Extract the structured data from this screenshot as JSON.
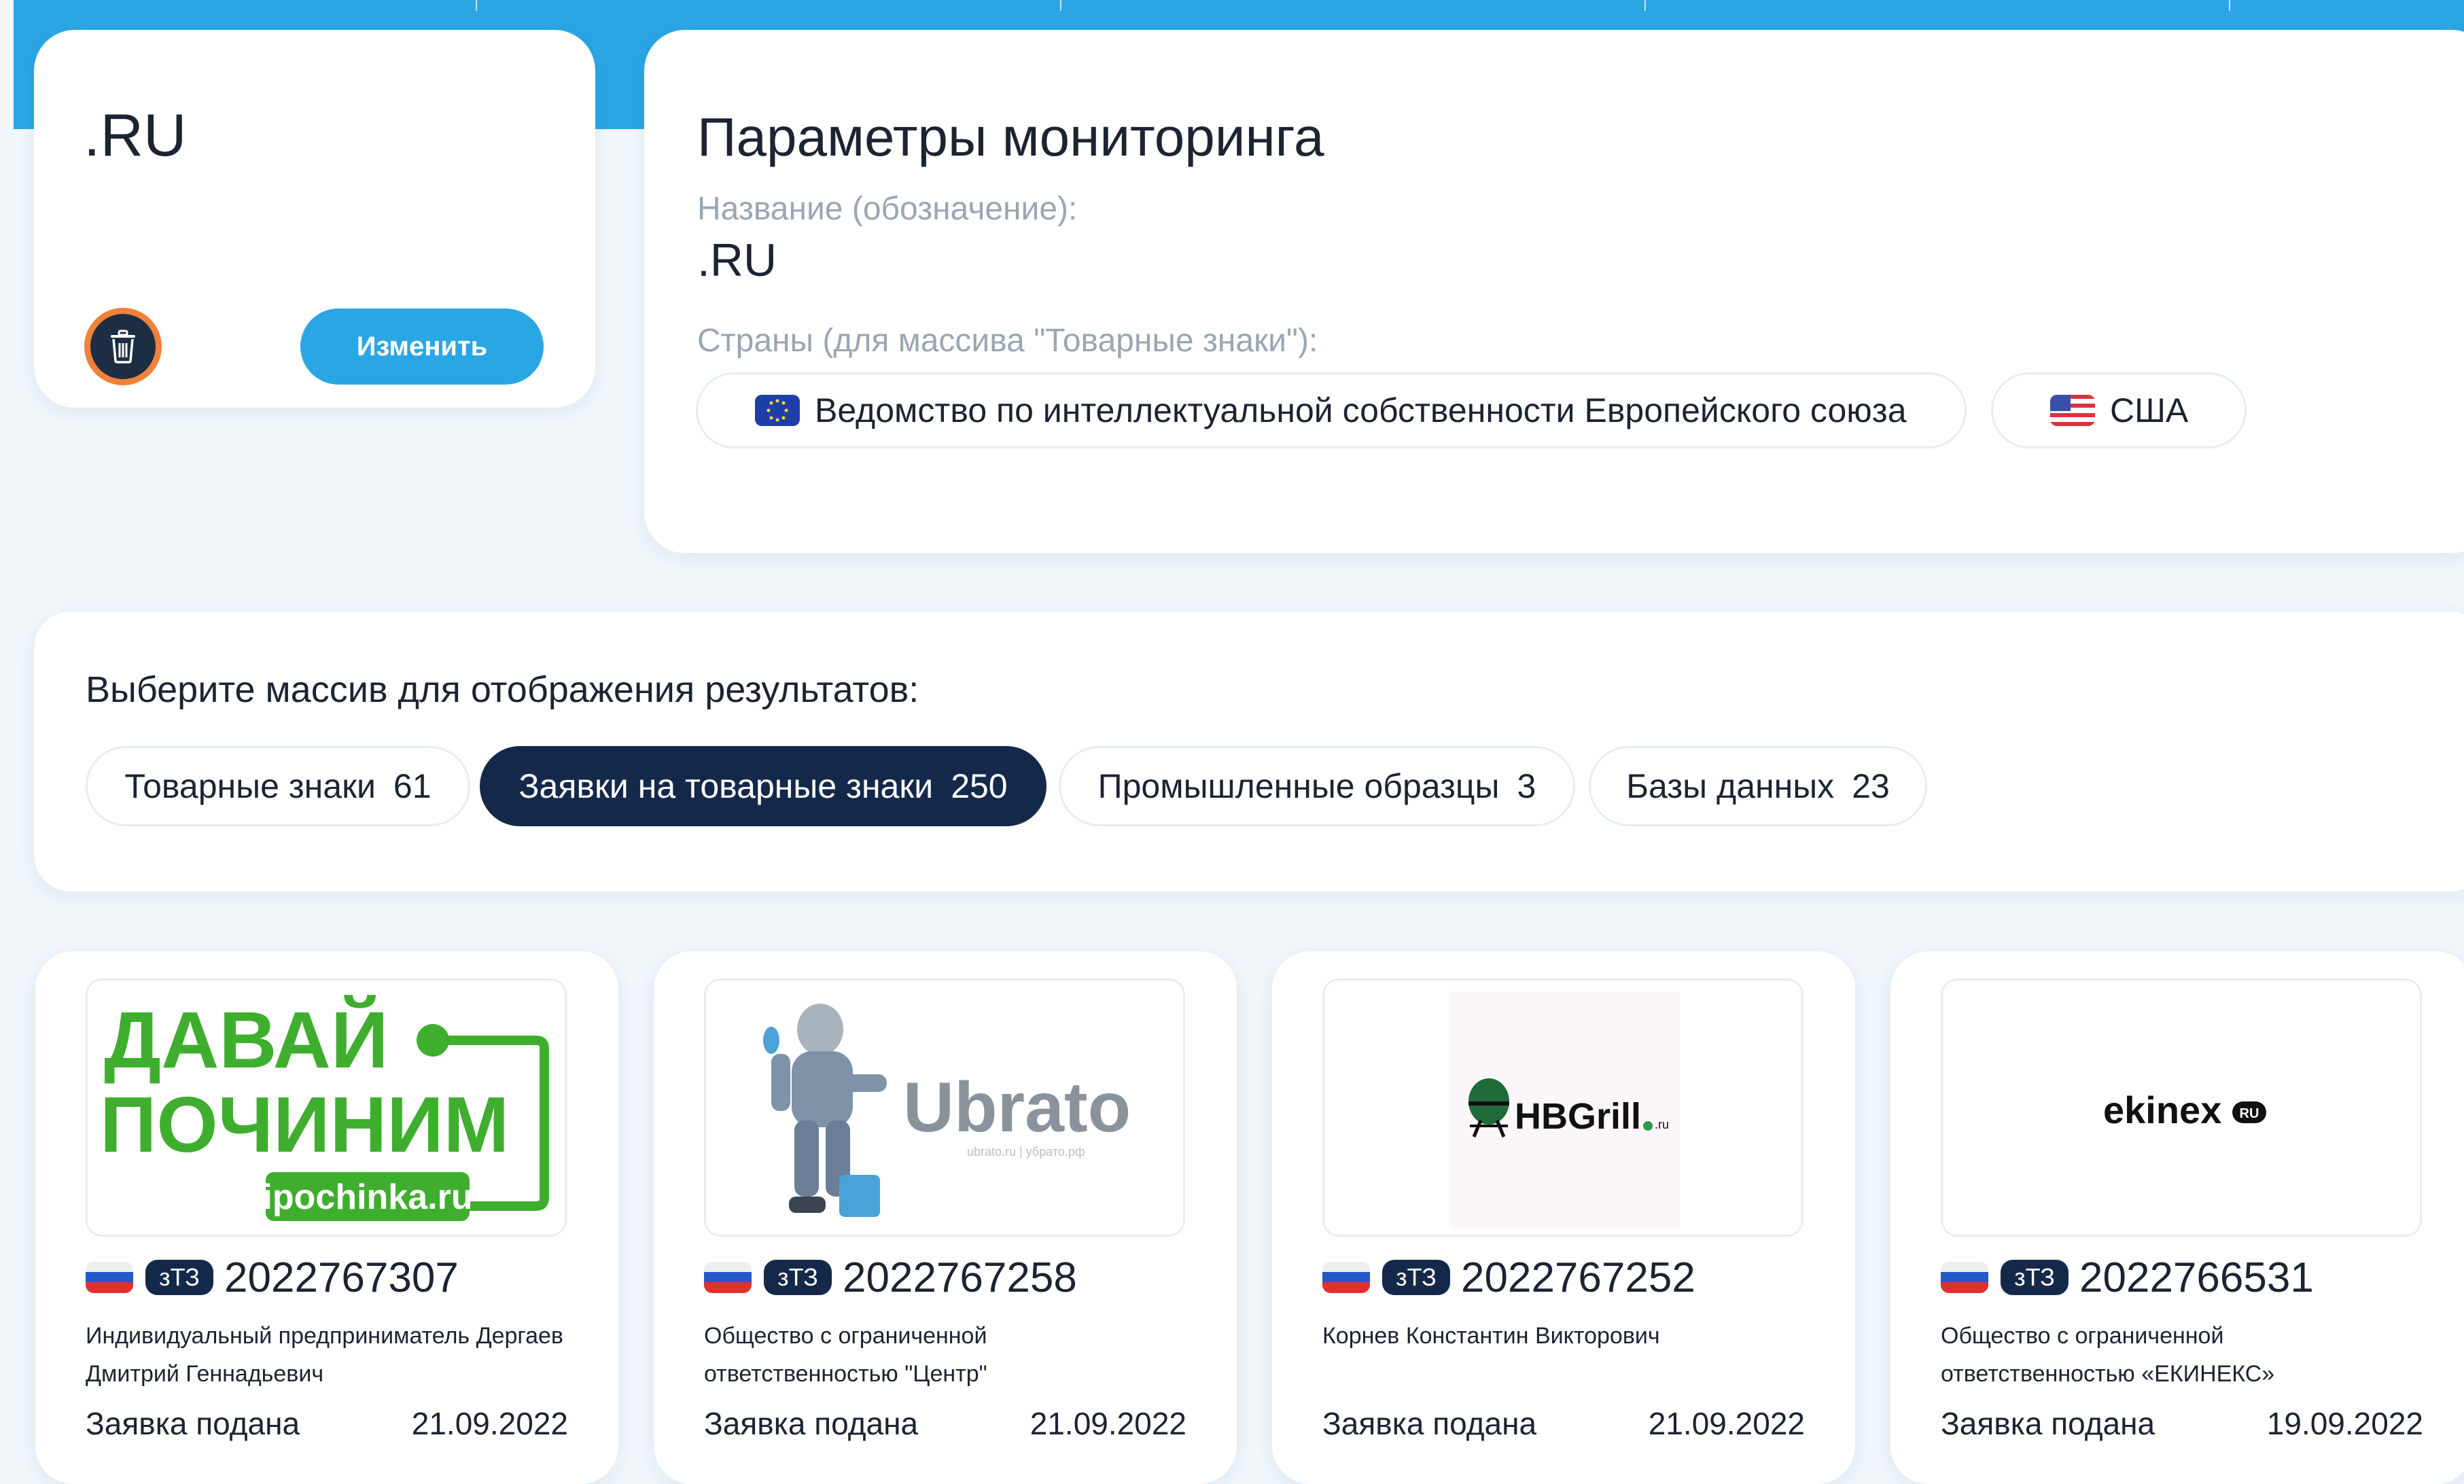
{
  "watch": {
    "title": ".RU",
    "edit_label": "Изменить"
  },
  "params": {
    "heading": "Параметры мониторинга",
    "name_label": "Название (обозначение):",
    "name_value": ".RU",
    "countries_label": "Страны (для массива \"Товарные знаки\"):",
    "countries": [
      {
        "label": "Ведомство по интеллектуальной собственности Европейского союза",
        "icon": "eu-flag-icon"
      },
      {
        "label": "США",
        "icon": "us-flag-icon"
      }
    ]
  },
  "results": {
    "prompt": "Выберите массив для отображения результатов:",
    "tabs": [
      {
        "label": "Товарные знаки",
        "count": "61",
        "active": false
      },
      {
        "label": "Заявки на товарные знаки",
        "count": "250",
        "active": true
      },
      {
        "label": "Промышленные образцы",
        "count": "3",
        "active": false
      },
      {
        "label": "Базы данных",
        "count": "23",
        "active": false
      }
    ]
  },
  "cards": [
    {
      "badge": "зТЗ",
      "number": "2022767307",
      "owner": "Индивидуальный предприниматель Деpгаев Дмитрий Геннадьевич",
      "status": "Заявка подана",
      "date": "21.09.2022",
      "logo": {
        "line1": "ДАВАЙ",
        "line2": "ПОЧИНИМ",
        "line3": "ipochinka.ru"
      }
    },
    {
      "badge": "зТЗ",
      "number": "2022767258",
      "owner": "Общество с ограниченной ответственностью \"Центр\"",
      "status": "Заявка подана",
      "date": "21.09.2022",
      "logo": {
        "brand": "Ubrato",
        "sub": "ubrato.ru | убрато.рф"
      }
    },
    {
      "badge": "зТЗ",
      "number": "2022767252",
      "owner": "Корнев Константин Викторович",
      "status": "Заявка подана",
      "date": "21.09.2022",
      "logo": {
        "brand": "HBGrill",
        "sub": ".ru"
      }
    },
    {
      "badge": "зТЗ",
      "number": "2022766531",
      "owner": "Общество с ограниченной ответственностью «ЕКИНЕКС»",
      "status": "Заявка подана",
      "date": "19.09.2022",
      "logo": {
        "brand": "ekinex",
        "sub": "RU"
      }
    }
  ],
  "colors": {
    "accent": "#2ba6e4",
    "navy": "#14294a",
    "danger_ring": "#f0823a",
    "logo_green": "#3fae2f"
  }
}
